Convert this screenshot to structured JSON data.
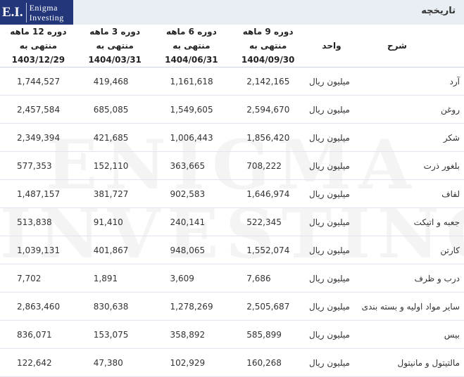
{
  "logo": {
    "mark": "E.I.",
    "line1": "Enigma",
    "line2": "Investing"
  },
  "watermark": {
    "line1": "ENIGMA",
    "line2": "INVESTING"
  },
  "page_title": "تاریخچه",
  "columns": {
    "description": "شرح",
    "unit": "واحد",
    "periods": [
      {
        "line1": "دوره 9 ماهه منتهی به",
        "line2": "1404/09/30"
      },
      {
        "line1": "دوره 6 ماهه منتهی به",
        "line2": "1404/06/31"
      },
      {
        "line1": "دوره 3 ماهه منتهی به",
        "line2": "1404/03/31"
      },
      {
        "line1": "دوره 12 ماهه منتهی به",
        "line2": "1403/12/29"
      }
    ]
  },
  "rows": [
    {
      "desc": "آرد",
      "unit": "میلیون ریال",
      "v": [
        "2,142,165",
        "1,161,618",
        "419,468",
        "1,744,527"
      ]
    },
    {
      "desc": "روغن",
      "unit": "میلیون ریال",
      "v": [
        "2,594,670",
        "1,549,605",
        "685,085",
        "2,457,584"
      ]
    },
    {
      "desc": "شکر",
      "unit": "میلیون ریال",
      "v": [
        "1,856,420",
        "1,006,443",
        "421,685",
        "2,349,394"
      ]
    },
    {
      "desc": "بلغور ذرت",
      "unit": "میلیون ریال",
      "v": [
        "708,222",
        "363,665",
        "152,110",
        "577,353"
      ]
    },
    {
      "desc": "لفاف",
      "unit": "میلیون ریال",
      "v": [
        "1,646,974",
        "902,583",
        "381,727",
        "1,487,157"
      ]
    },
    {
      "desc": "جعبه و اتیکت",
      "unit": "میلیون ریال",
      "v": [
        "522,345",
        "240,141",
        "91,410",
        "513,838"
      ]
    },
    {
      "desc": "کارتن",
      "unit": "میلیون ریال",
      "v": [
        "1,552,074",
        "948,065",
        "401,867",
        "1,039,131"
      ]
    },
    {
      "desc": "درب و ظرف",
      "unit": "میلیون ریال",
      "v": [
        "7,686",
        "3,609",
        "1,891",
        "7,702"
      ]
    },
    {
      "desc": "سایر مواد اولیه و بسته بندی",
      "unit": "میلیون ریال",
      "v": [
        "2,505,687",
        "1,278,269",
        "830,638",
        "2,863,460"
      ]
    },
    {
      "desc": "بیس",
      "unit": "میلیون ریال",
      "v": [
        "585,899",
        "358,892",
        "153,075",
        "836,071"
      ]
    },
    {
      "desc": "مالتیتول و مانیتول",
      "unit": "میلیون ریال",
      "v": [
        "160,268",
        "102,929",
        "47,380",
        "122,642"
      ]
    }
  ]
}
